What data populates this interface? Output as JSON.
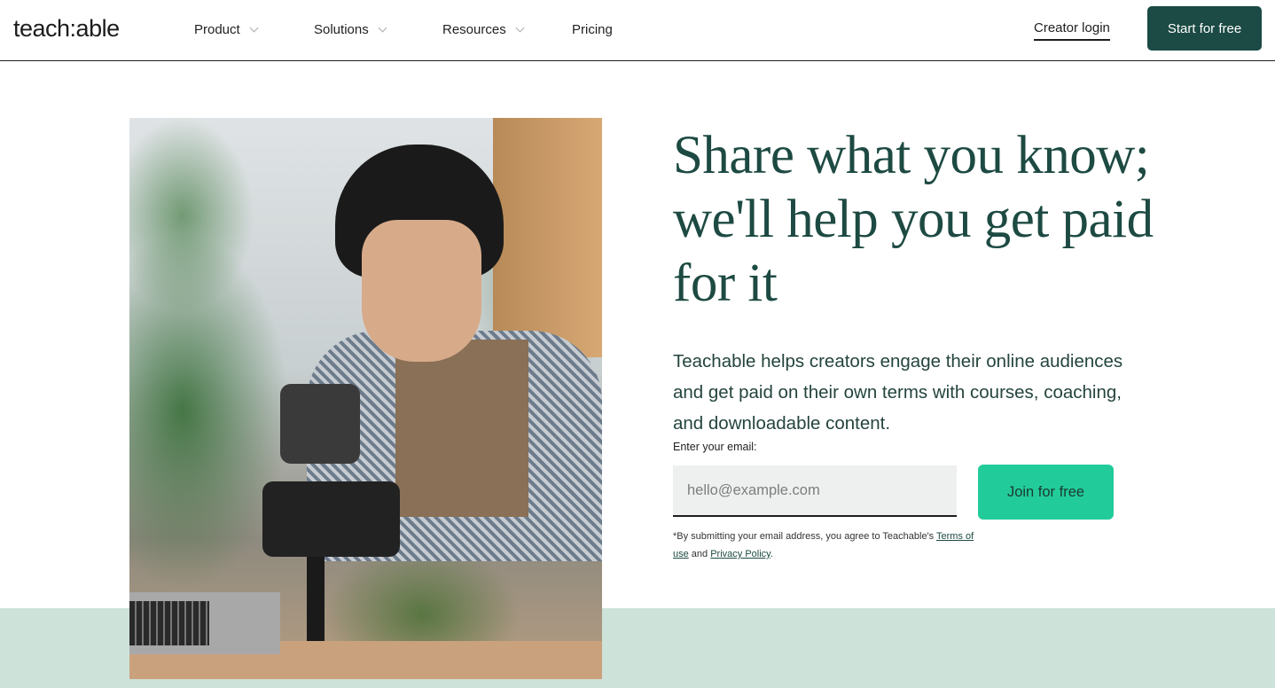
{
  "nav": {
    "logo": "teach:able",
    "items": [
      {
        "label": "Product",
        "has_dropdown": true
      },
      {
        "label": "Solutions",
        "has_dropdown": true
      },
      {
        "label": "Resources",
        "has_dropdown": true
      },
      {
        "label": "Pricing",
        "has_dropdown": false
      }
    ],
    "login_label": "Creator login",
    "start_label": "Start for free"
  },
  "hero": {
    "headline": "Share what you know; we'll help you get paid for it",
    "subtext": "Teachable helps creators engage their online audiences and get paid on their own terms with courses, coaching, and downloadable content.",
    "image_alt": "Creator filming plants with a phone on a tripod",
    "form": {
      "label": "Enter your email:",
      "placeholder": "hello@example.com",
      "value": "",
      "submit_label": "Join for free"
    },
    "legal": {
      "prefix": "*By submitting your email address, you agree to Teachable's ",
      "terms_label": "Terms of use",
      "middle": " and ",
      "privacy_label": "Privacy Policy",
      "suffix": "."
    }
  },
  "colors": {
    "brand_dark": "#1c4a44",
    "accent_green": "#22cc9a",
    "band": "#cde2d9"
  }
}
